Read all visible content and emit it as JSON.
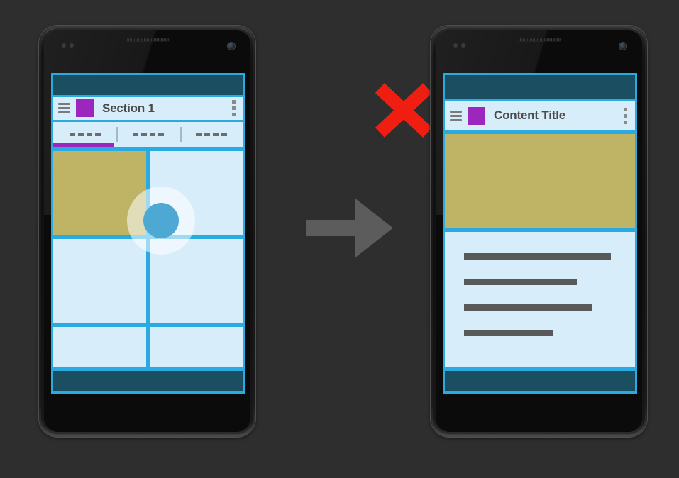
{
  "background_color": "#2e2e2e",
  "accent_color": "#29abe2",
  "surface_color": "#d7edfa",
  "chrome_color": "#1b4e61",
  "brand_color": "#9b27bf",
  "image_placeholder_color": "#bfb465",
  "touch_color": "#4ea8d4",
  "error_color": "#f01e10",
  "arrow_color": "#5c5c5c",
  "phone_left": {
    "label": "master-list-phone",
    "statusbar": {
      "label": "status-bar"
    },
    "appbar": {
      "menu_icon": "hamburger-menu-icon",
      "app_swatch": "app-color-swatch",
      "title": "Section 1",
      "overflow_icon": "overflow-menu-icon"
    },
    "tabs": [
      {
        "label": "----",
        "selected": true
      },
      {
        "label": "----",
        "selected": false
      },
      {
        "label": "----",
        "selected": false
      }
    ],
    "grid": [
      [
        {
          "type": "image",
          "selected": true
        },
        {
          "type": "blank",
          "selected": false
        }
      ],
      [
        {
          "type": "blank",
          "selected": false
        },
        {
          "type": "blank",
          "selected": false
        }
      ],
      [
        {
          "type": "blank",
          "selected": false
        },
        {
          "type": "blank",
          "selected": false
        }
      ]
    ],
    "touch_indicator": "tap-target-ripple",
    "navbar": {
      "label": "navigation-bar"
    }
  },
  "phone_right": {
    "label": "detail-view-phone",
    "statusbar": {
      "label": "status-bar"
    },
    "appbar": {
      "menu_icon": "hamburger-menu-icon",
      "app_swatch": "app-color-swatch",
      "title": "Content Title",
      "overflow_icon": "overflow-menu-icon"
    },
    "hero": {
      "label": "hero-image-placeholder"
    },
    "text_lines": [
      {
        "width": "86%"
      },
      {
        "width": "66%"
      },
      {
        "width": "75%"
      },
      {
        "width": "52%"
      }
    ],
    "navbar": {
      "label": "navigation-bar"
    }
  },
  "annotations": {
    "error_mark": "red-x-mark",
    "transition_arrow": "right-arrow"
  }
}
